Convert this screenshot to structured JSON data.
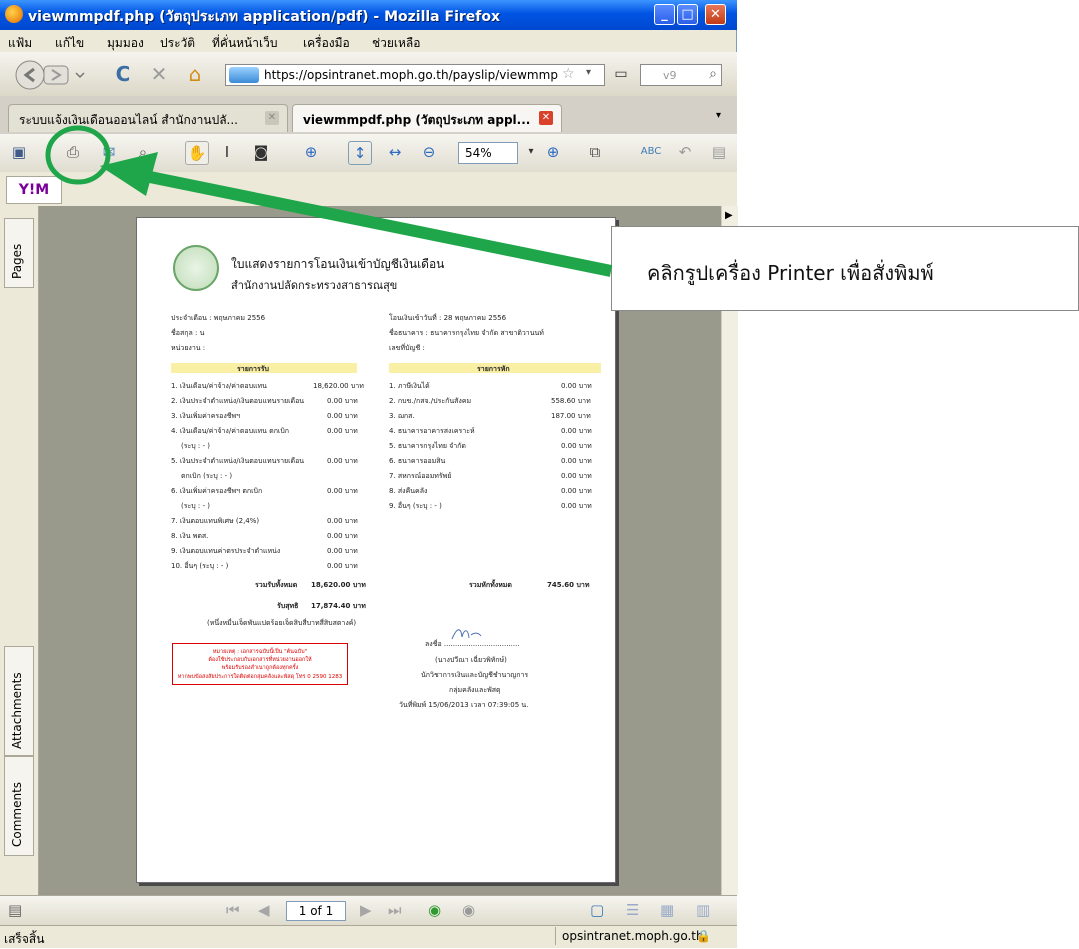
{
  "window": {
    "title": "viewmmpdf.php (วัตถุประเภท application/pdf) - Mozilla Firefox",
    "minimize": "_",
    "maximize": "□",
    "close": "✕"
  },
  "menu": [
    "แฟ้ม",
    "แก้ไข",
    "มุมมอง",
    "ประวัติ",
    "ที่คั่นหน้าเว็บ",
    "เครื่องมือ",
    "ช่วยเหลือ"
  ],
  "navbar": {
    "url": "https://opsintranet.moph.go.th/payslip/viewmmp",
    "search_placeholder": "v9"
  },
  "tabs": [
    {
      "label": "ระบบแจ้งเงินเดือนออนไลน์ สำนักงานปลั...",
      "active": false
    },
    {
      "label": "viewmmpdf.php (วัตถุประเภท appl...",
      "active": true
    }
  ],
  "pdf_toolbar": {
    "zoom": "54%",
    "icons": [
      "save-icon",
      "print-icon",
      "email-icon",
      "find-icon",
      "hand-tool-icon",
      "select-text-icon",
      "snapshot-icon",
      "zoom-in-icon",
      "fit-page-icon",
      "fit-width-icon",
      "zoom-out-icon",
      "zoom-plus-icon",
      "pages-icon",
      "spellcheck-icon",
      "undo-icon",
      "copy-icon"
    ]
  },
  "yahoo_tab": "Y!M",
  "side_tabs": {
    "pages": "Pages",
    "attachments": "Attachments",
    "comments": "Comments"
  },
  "pdf": {
    "title": "ใบแสดงรายการโอนเงินเข้าบัญชีเงินเดือน",
    "subtitle": "สำนักงานปลัดกระทรวงสาธารณสุข",
    "month": "ประจำเดือน : พฤษภาคม 2556",
    "name": "ชื่อสกุล : น",
    "unit": "หน่วยงาน :",
    "transfer_date": "โอนเงินเข้าวันที่ : 28 พฤษภาคม 2556",
    "bank": "ชื่อธนาคาร : ธนาคารกรุงไทย จำกัด สาขาติวานนท์",
    "account": "เลขที่บัญชี :",
    "income_header": "รายการรับ",
    "deduct_header": "รายการหัก",
    "income": [
      {
        "label": "1. เงินเดือน/ค่าจ้าง/ค่าตอบแทน",
        "value": "18,620.00 บาท"
      },
      {
        "label": "2. เงินประจำตำแหน่ง/เงินตอบแทนรายเดือน",
        "value": "0.00 บาท"
      },
      {
        "label": "3. เงินเพิ่มค่าครองชีพฯ",
        "value": "0.00 บาท"
      },
      {
        "label": "4. เงินเดือน/ค่าจ้าง/ค่าตอบแทน ตกเบิก",
        "value": "0.00 บาท"
      },
      {
        "label": "(ระบุ : - )",
        "value": ""
      },
      {
        "label": "5. เงินประจำตำแหน่ง/เงินตอบแทนรายเดือน",
        "value": "0.00 บาท"
      },
      {
        "label": "ตกเบิก (ระบุ : - )",
        "value": ""
      },
      {
        "label": "6. เงินเพิ่มค่าครองชีพฯ ตกเบิก",
        "value": "0.00 บาท"
      },
      {
        "label": "(ระบุ : - )",
        "value": ""
      },
      {
        "label": "7. เงินตอบแทนพิเศษ (2,4%)",
        "value": "0.00 บาท"
      },
      {
        "label": "8. เงิน พตส.",
        "value": "0.00 บาท"
      },
      {
        "label": "9. เงินตอบแทนค่าตรประจำตำแหน่ง",
        "value": "0.00 บาท"
      },
      {
        "label": "10. อื่นๆ (ระบุ : - )",
        "value": "0.00 บาท"
      }
    ],
    "deductions": [
      {
        "label": "1. ภาษีเงินได้",
        "value": "0.00 บาท"
      },
      {
        "label": "2. กบข./กสจ./ประกันสังคม",
        "value": "558.60 บาท"
      },
      {
        "label": "3. ฌกส.",
        "value": "187.00 บาท"
      },
      {
        "label": "4. ธนาคารอาคารสงเคราะห์",
        "value": "0.00 บาท"
      },
      {
        "label": "5. ธนาคารกรุงไทย จำกัด",
        "value": "0.00 บาท"
      },
      {
        "label": "6. ธนาคารออมสิน",
        "value": "0.00 บาท"
      },
      {
        "label": "7. สหกรณ์ออมทรัพย์",
        "value": "0.00 บาท"
      },
      {
        "label": "8. ส่งคืนคลัง",
        "value": "0.00 บาท"
      },
      {
        "label": "9. อื่นๆ (ระบุ : - )",
        "value": "0.00 บาท"
      }
    ],
    "total_income_label": "รวมรับทั้งหมด",
    "total_income": "18,620.00 บาท",
    "total_deduct_label": "รวมหักทั้งหมด",
    "total_deduct": "745.60 บาท",
    "net_label": "รับสุทธิ",
    "net": "17,874.40 บาท",
    "net_words": "(หนึ่งหมื่นเจ็ดพันแปดร้อยเจ็ดสิบสี่บาทสี่สิบสตางค์)",
    "notice": [
      "หมายเหตุ : เอกสารฉบับนี้เป็น \"ต้นฉบับ\"",
      "ต้องใช้ประกอบกับเอกสารที่หน่วยงานออกให้",
      "พร้อมรับรองสำเนาถูกต้องทุกครั้ง",
      "หากพบข้อสงสัยประการใดติดต่อกลุ่มคลังและพัสดุ โทร 0 2590 1283"
    ],
    "sign_line": "ลงชื่อ ..................................",
    "sign_name": "(นางปวีณา   เฉี่ยวพิทักษ์)",
    "sign_position": "นักวิชาการเงินและบัญชีชำนาญการ",
    "sign_dept": "กลุ่มคลังและพัสดุ",
    "print_date": "วันที่พิมพ์ 15/06/2013 เวลา 07:39:05 น."
  },
  "page_nav": {
    "current": "1 of 1"
  },
  "status": {
    "left": "เสร็จสิ้น",
    "right": "opsintranet.moph.go.th"
  },
  "callout": "คลิกรูปเครื่อง Printer เพื่อสั่งพิมพ์",
  "colors": {
    "annotation_green": "#1fa64a",
    "xp_blue": "#0054e3"
  }
}
